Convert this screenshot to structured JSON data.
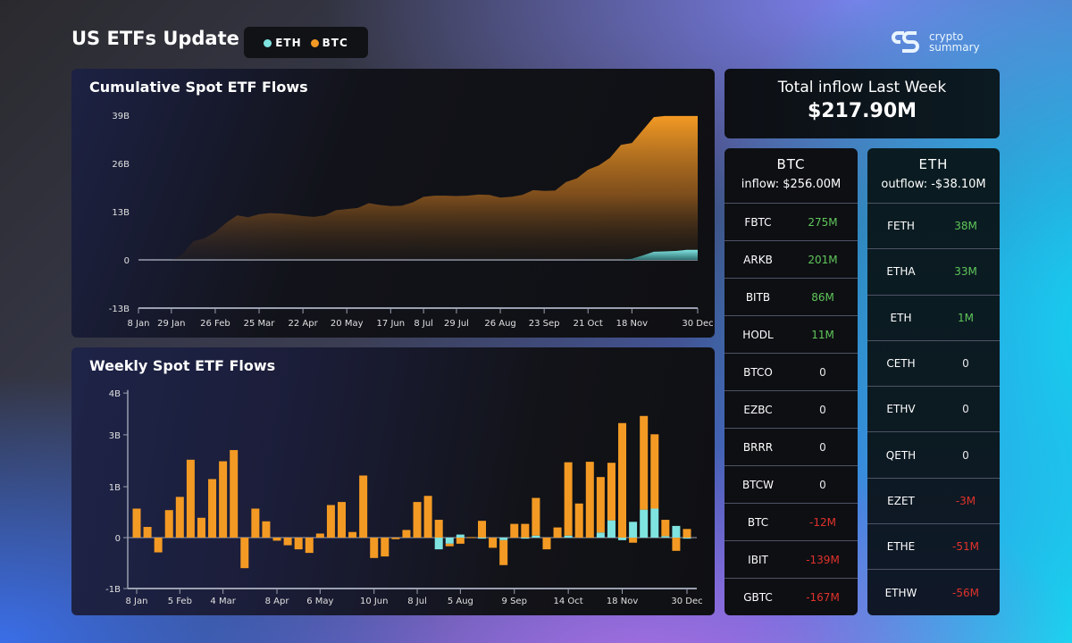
{
  "header": {
    "title": "US ETFs Update",
    "legend": [
      {
        "label": "ETH",
        "color": "#7fe3e0"
      },
      {
        "label": "BTC",
        "color": "#f39a24"
      }
    ],
    "logo_line1": "crypto",
    "logo_line2": "summary"
  },
  "cumulative": {
    "title": "Cumulative Spot ETF Flows",
    "chart_data": {
      "type": "area",
      "stacked": false,
      "y_ticks": [
        "39B",
        "26B",
        "13B",
        "0",
        "-13B"
      ],
      "ylim": [
        -13,
        39
      ],
      "yunit": "B",
      "x_ticks": [
        "8 Jan",
        "29 Jan",
        "26 Feb",
        "25 Mar",
        "22 Apr",
        "20 May",
        "17 Jun",
        "8 Jul",
        "29 Jul",
        "26 Aug",
        "23 Sep",
        "21 Oct",
        "18 Nov",
        "30 Dec"
      ],
      "x": [
        "8 Jan",
        "15 Jan",
        "22 Jan",
        "29 Jan",
        "5 Feb",
        "12 Feb",
        "19 Feb",
        "26 Feb",
        "4 Mar",
        "11 Mar",
        "18 Mar",
        "25 Mar",
        "1 Apr",
        "8 Apr",
        "15 Apr",
        "22 Apr",
        "29 Apr",
        "6 May",
        "13 May",
        "20 May",
        "27 May",
        "3 Jun",
        "10 Jun",
        "17 Jun",
        "24 Jun",
        "1 Jul",
        "8 Jul",
        "15 Jul",
        "22 Jul",
        "29 Jul",
        "5 Aug",
        "12 Aug",
        "19 Aug",
        "26 Aug",
        "2 Sep",
        "9 Sep",
        "16 Sep",
        "23 Sep",
        "30 Sep",
        "7 Oct",
        "14 Oct",
        "21 Oct",
        "28 Oct",
        "4 Nov",
        "11 Nov",
        "18 Nov",
        "25 Nov",
        "2 Dec",
        "9 Dec",
        "16 Dec",
        "23 Dec",
        "30 Dec"
      ],
      "series": [
        {
          "name": "BTC",
          "color": "#f39a24",
          "values": [
            0,
            0,
            0,
            0,
            1.5,
            5,
            5.8,
            7.5,
            10,
            12,
            11.5,
            12.3,
            12.6,
            12.5,
            12.2,
            11.8,
            11.6,
            12,
            13.4,
            13.7,
            14,
            15.3,
            14.8,
            14.5,
            14.6,
            15.5,
            17,
            17.3,
            17.3,
            17.2,
            17.3,
            17.6,
            17.5,
            16.8,
            17,
            17.5,
            18.8,
            18.6,
            18.7,
            21,
            22,
            24.3,
            25.5,
            27.5,
            31,
            31.5,
            35,
            38.5,
            38.8,
            38.8,
            38.8,
            38.8
          ]
        },
        {
          "name": "ETH",
          "color": "#7fe3e0",
          "values": [
            0,
            0,
            0,
            0,
            0,
            0,
            0,
            0,
            0,
            0,
            0,
            0,
            0,
            0,
            0,
            0,
            0,
            0,
            0,
            0,
            0,
            0,
            0,
            0,
            0,
            0,
            0,
            0,
            0,
            0,
            0,
            0,
            0,
            0,
            0,
            0,
            0,
            0,
            0,
            0,
            0,
            0,
            0,
            0,
            0,
            0.3,
            1.2,
            2.2,
            2.3,
            2.4,
            2.7,
            2.7
          ]
        }
      ]
    }
  },
  "weekly": {
    "title": "Weekly Spot ETF Flows",
    "chart_data": {
      "type": "bar",
      "stacked": true,
      "y_ticks": [
        {
          "label": "4B",
          "value": 2.84
        },
        {
          "label": "3B",
          "value": 2.02
        },
        {
          "label": "1B",
          "value": 1
        },
        {
          "label": "0",
          "value": 0
        },
        {
          "label": "-1B",
          "value": -1
        }
      ],
      "x_ticks": [
        "8 Jan",
        "5 Feb",
        "4 Mar",
        "8 Apr",
        "6 May",
        "10 Jun",
        "8 Jul",
        "5 Aug",
        "9 Sep",
        "14 Oct",
        "18 Nov",
        "30 Dec"
      ],
      "series": [
        {
          "name": "BTC",
          "color": "#f39a24",
          "values": [
            0.57,
            0.21,
            -0.29,
            0.54,
            0.8,
            1.53,
            0.39,
            1.15,
            1.5,
            1.72,
            -0.6,
            0.57,
            0.32,
            -0.06,
            -0.15,
            -0.23,
            -0.3,
            0.08,
            0.64,
            0.7,
            0.11,
            1.22,
            -0.4,
            -0.37,
            -0.03,
            0.15,
            0.7,
            0.82,
            0.35,
            -0.05,
            -0.12,
            0.01,
            0.33,
            -0.2,
            -0.49,
            0.27,
            0.27,
            0.74,
            -0.23,
            0.2,
            1.44,
            0.67,
            1.49,
            1.09,
            1.13,
            2.25,
            -0.1,
            1.84,
            1.46,
            0.32,
            -0.26,
            0.17
          ]
        },
        {
          "name": "ETH",
          "color": "#7fe3e0",
          "values": [
            0,
            0,
            0,
            0,
            0,
            0,
            0,
            0,
            0,
            0,
            0,
            0,
            0,
            0,
            0,
            0,
            0,
            0,
            0,
            0,
            0,
            0,
            0,
            0,
            0,
            0,
            0,
            0,
            -0.23,
            -0.12,
            0.06,
            0,
            -0.02,
            0,
            -0.05,
            0,
            -0.02,
            0.04,
            0,
            0,
            0.04,
            0,
            0,
            0.1,
            0.34,
            -0.05,
            0.31,
            0.55,
            0.57,
            0.03,
            0.23,
            -0.02
          ]
        }
      ]
    }
  },
  "summary": {
    "label": "Total inflow Last Week",
    "value": "$217.90M"
  },
  "btc": {
    "name": "BTC",
    "flow": "inflow: $256.00M",
    "rows": [
      {
        "t": "FBTC",
        "v": "275M",
        "s": "pos"
      },
      {
        "t": "ARKB",
        "v": "201M",
        "s": "pos"
      },
      {
        "t": "BITB",
        "v": "86M",
        "s": "pos"
      },
      {
        "t": "HODL",
        "v": "11M",
        "s": "pos"
      },
      {
        "t": "BTCO",
        "v": "0",
        "s": "zero"
      },
      {
        "t": "EZBC",
        "v": "0",
        "s": "zero"
      },
      {
        "t": "BRRR",
        "v": "0",
        "s": "zero"
      },
      {
        "t": "BTCW",
        "v": "0",
        "s": "zero"
      },
      {
        "t": "BTC",
        "v": "-12M",
        "s": "neg"
      },
      {
        "t": "IBIT",
        "v": "-139M",
        "s": "neg"
      },
      {
        "t": "GBTC",
        "v": "-167M",
        "s": "neg"
      }
    ]
  },
  "eth": {
    "name": "ETH",
    "flow": "outflow: -$38.10M",
    "rows": [
      {
        "t": "FETH",
        "v": "38M",
        "s": "pos"
      },
      {
        "t": "ETHA",
        "v": "33M",
        "s": "pos"
      },
      {
        "t": "ETH",
        "v": "1M",
        "s": "pos"
      },
      {
        "t": "CETH",
        "v": "0",
        "s": "zero"
      },
      {
        "t": "ETHV",
        "v": "0",
        "s": "zero"
      },
      {
        "t": "QETH",
        "v": "0",
        "s": "zero"
      },
      {
        "t": "EZET",
        "v": "-3M",
        "s": "neg"
      },
      {
        "t": "ETHE",
        "v": "-51M",
        "s": "neg"
      },
      {
        "t": "ETHW",
        "v": "-56M",
        "s": "neg"
      }
    ]
  }
}
